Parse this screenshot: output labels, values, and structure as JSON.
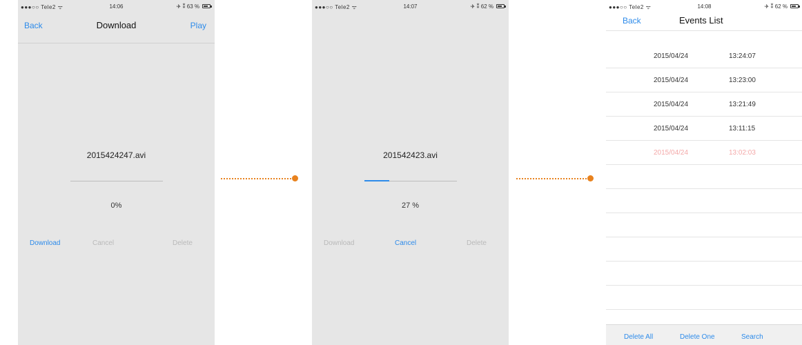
{
  "screens": [
    {
      "status": {
        "carrier": "●●●○○ Tele2 ᯤ",
        "time": "14:06",
        "battery": "✈ ⁑ 63 %"
      },
      "nav": {
        "back": "Back",
        "title": "Download",
        "play": "Play"
      },
      "filename": "2015424247.avi",
      "progress": 0,
      "percent_label": "0%",
      "actions": {
        "download": "Download",
        "cancel": "Cancel",
        "delete": "Delete"
      }
    },
    {
      "status": {
        "carrier": "●●●○○ Tele2 ᯤ",
        "time": "14:07",
        "battery": "✈ ⁑ 62 %"
      },
      "filename": "201542423.avi",
      "progress": 27,
      "percent_label": "27 %",
      "actions": {
        "download": "Download",
        "cancel": "Cancel",
        "delete": "Delete"
      }
    },
    {
      "status": {
        "carrier": "●●●○○ Tele2 ᯤ",
        "time": "14:08",
        "battery": "✈ ⁑ 62 %"
      },
      "nav": {
        "back": "Back",
        "title": "Events List"
      },
      "events": [
        {
          "date": "2015/04/24",
          "time": "13:24:07"
        },
        {
          "date": "2015/04/24",
          "time": "13:23:00"
        },
        {
          "date": "2015/04/24",
          "time": "13:21:49"
        },
        {
          "date": "2015/04/24",
          "time": "13:11:15"
        },
        {
          "date": "2015/04/24",
          "time": "13:02:03"
        }
      ],
      "toolbar": {
        "delete_all": "Delete All",
        "delete_one": "Delete One",
        "search": "Search"
      }
    }
  ],
  "colors": {
    "accent": "#2d8bea",
    "disabled": "#b9b9b9",
    "highlight_row": "#f4a8a8",
    "connector": "#e8821e"
  }
}
